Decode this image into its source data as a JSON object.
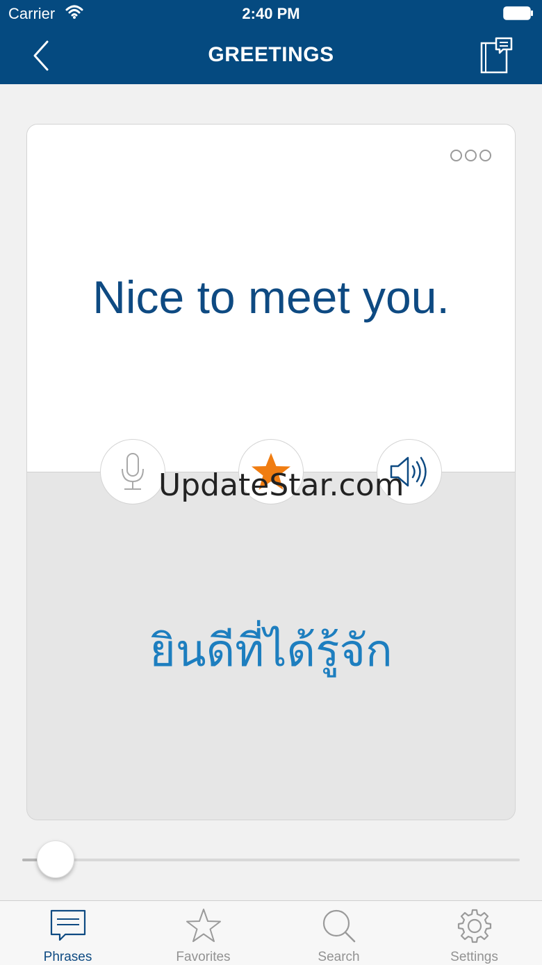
{
  "status_bar": {
    "carrier": "Carrier",
    "time": "2:40 PM"
  },
  "nav": {
    "title": "GREETINGS"
  },
  "card": {
    "english": "Nice to meet you.",
    "thai": "ยินดีที่ได้รู้จัก"
  },
  "watermark": "UpdateStar.com",
  "slider": {
    "value_fraction": 0.06
  },
  "tabs": [
    {
      "label": "Phrases",
      "icon": "speech-bubble-icon",
      "active": true
    },
    {
      "label": "Favorites",
      "icon": "star-icon",
      "active": false
    },
    {
      "label": "Search",
      "icon": "magnifier-icon",
      "active": false
    },
    {
      "label": "Settings",
      "icon": "gear-icon",
      "active": false
    }
  ],
  "colors": {
    "brand": "#054a80",
    "english_text": "#0e4a82",
    "thai_text": "#1d7ebf",
    "favorite_star": "#f07d12"
  }
}
